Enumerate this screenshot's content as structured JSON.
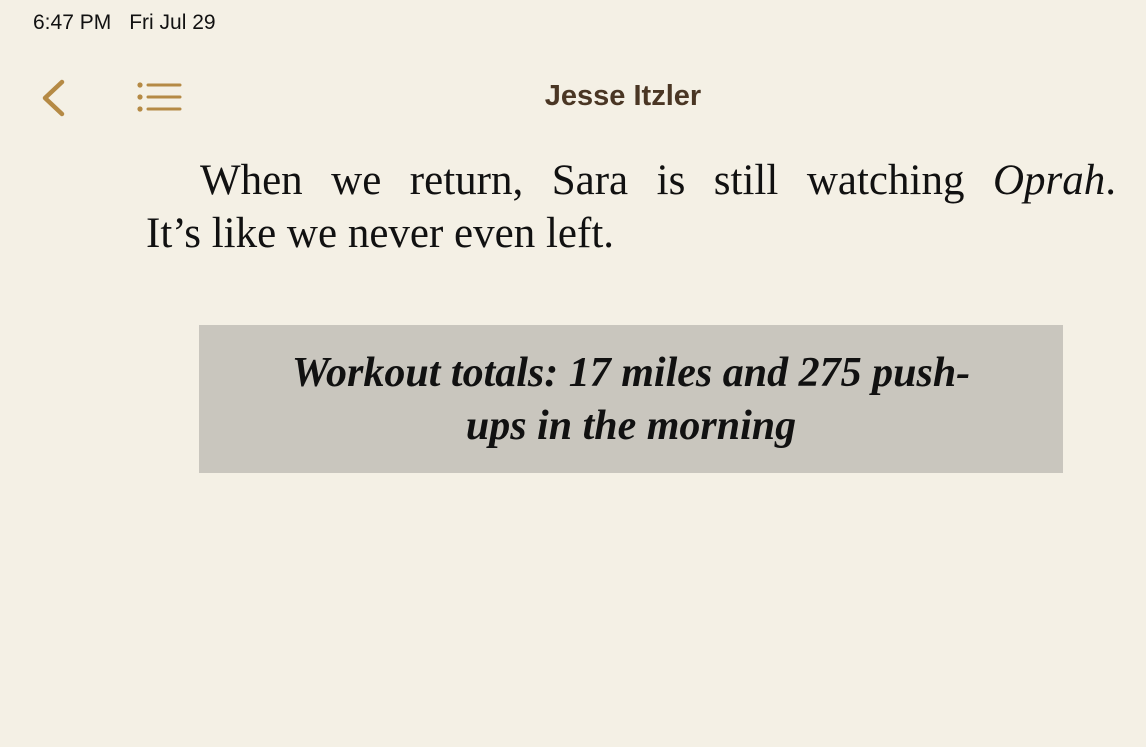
{
  "status_bar": {
    "time": "6:47 PM",
    "date": "Fri Jul 29"
  },
  "toolbar": {
    "back_icon": "chevron-left-icon",
    "toc_icon": "list-icon",
    "title": "Jesse Itzler",
    "accent_color": "#b58a45"
  },
  "content": {
    "paragraph_start": "When we return, Sara is still watching ",
    "paragraph_italic": "Oprah",
    "paragraph_end": ".",
    "paragraph_line2": "It’s like we never even left."
  },
  "callout": {
    "line1": "Workout totals: 17 miles and 275 push-",
    "line2": "ups in the morning",
    "background_color": "#c9c6be"
  }
}
